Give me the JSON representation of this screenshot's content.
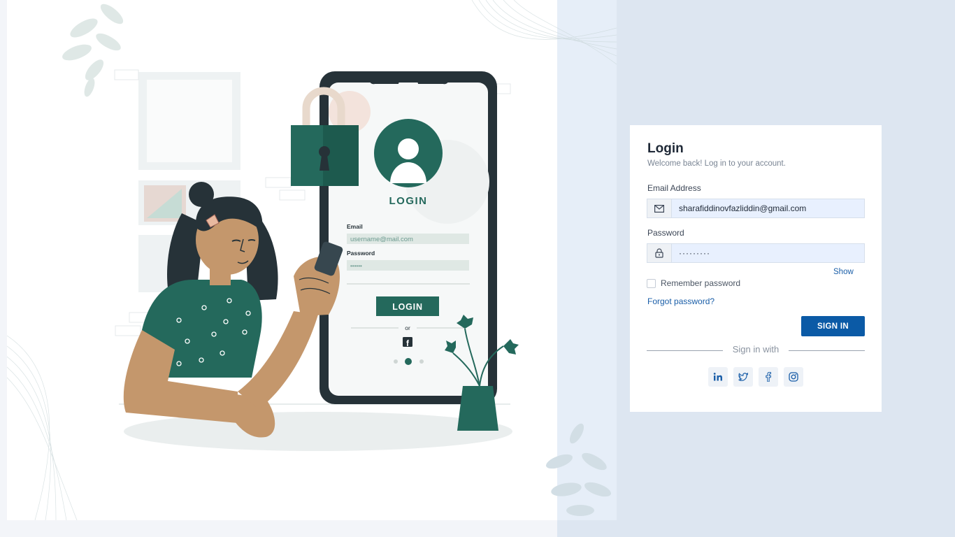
{
  "illustration": {
    "phone_title": "LOGIN",
    "phone_email_label": "Email",
    "phone_email_placeholder": "username@mail.com",
    "phone_password_label": "Password",
    "phone_password_dots": "••••••",
    "phone_button": "LOGIN",
    "phone_or": "or"
  },
  "card": {
    "title": "Login",
    "subtitle": "Welcome back! Log in to your account.",
    "email_label": "Email Address",
    "email_value": "sharafiddinovfazliddin@gmail.com",
    "password_label": "Password",
    "password_value": "·········",
    "show_label": "Show",
    "remember_label": "Remember password",
    "forgot_label": "Forgot password?",
    "signin_label": "SIGN IN",
    "divider_text": "Sign in with"
  },
  "socials": [
    "linkedin-icon",
    "twitter-icon",
    "facebook-icon",
    "instagram-icon"
  ],
  "colors": {
    "accent": "#0b5aa6",
    "illustration_green": "#24695c",
    "skin": "#c4976c",
    "page_bg": "#dde6f1"
  }
}
